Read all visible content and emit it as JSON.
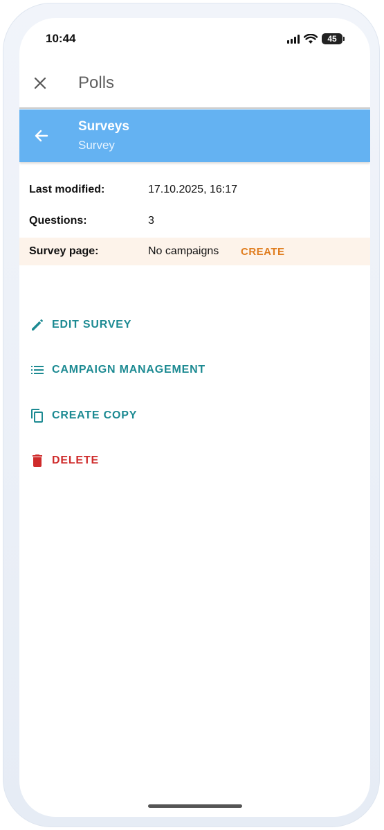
{
  "status": {
    "time": "10:44",
    "battery": "45"
  },
  "header": {
    "title": "Polls",
    "close_icon": "close-icon"
  },
  "bar": {
    "title": "Surveys",
    "subtitle": "Survey",
    "back_icon": "arrow-left-icon",
    "color": "#64b2f2"
  },
  "info": {
    "rows": [
      {
        "label": "Last modified:",
        "value": "17.10.2025, 16:17"
      },
      {
        "label": "Questions:",
        "value": "3"
      },
      {
        "label": "Survey page:",
        "value": "No campaigns",
        "action": "CREATE"
      }
    ]
  },
  "actions": [
    {
      "label": "EDIT SURVEY",
      "icon": "pencil-icon",
      "color": "#1c8a92"
    },
    {
      "label": "CAMPAIGN MANAGEMENT",
      "icon": "list-icon",
      "color": "#1c8a92"
    },
    {
      "label": "CREATE COPY",
      "icon": "copy-icon",
      "color": "#1c8a92"
    },
    {
      "label": "DELETE",
      "icon": "trash-icon",
      "color": "#cf2b2b"
    }
  ]
}
